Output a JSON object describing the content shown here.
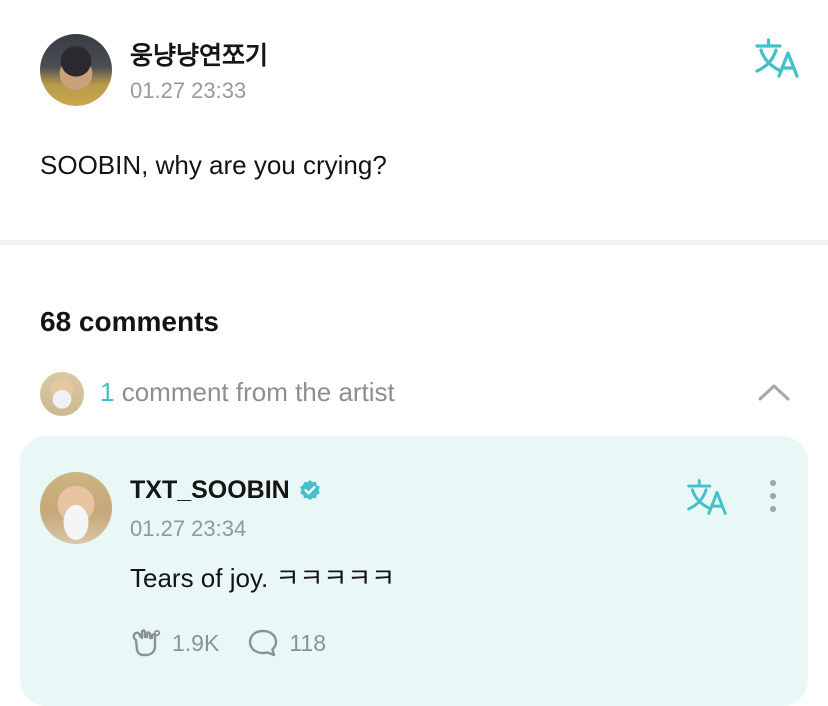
{
  "post": {
    "author": "웅냥냥연쪼기",
    "time": "01.27 23:33",
    "body": "SOOBIN, why are you crying?",
    "translate_icon": "translate-icon"
  },
  "comments": {
    "count_label": "68 comments",
    "artist_count": "1",
    "artist_label": "comment from the artist"
  },
  "artist_comment": {
    "name": "TXT_SOOBIN",
    "time": "01.27 23:34",
    "text": "Tears of joy. ㅋㅋㅋㅋㅋ",
    "likes": "1.9K",
    "replies": "118"
  },
  "colors": {
    "accent": "#45c0c8",
    "card_background": "#e9f8f7"
  }
}
